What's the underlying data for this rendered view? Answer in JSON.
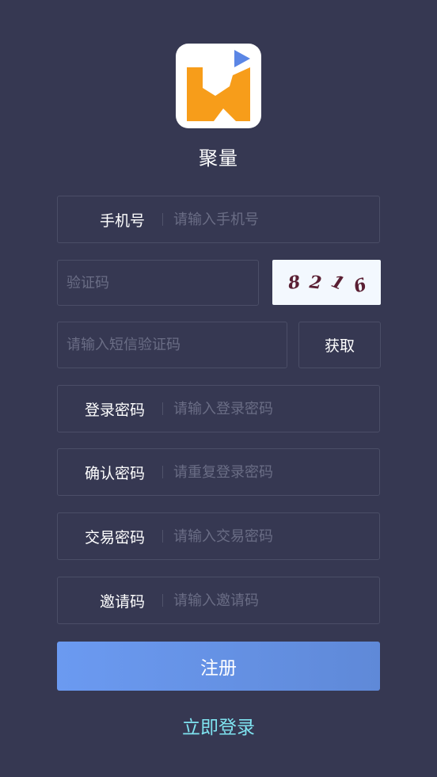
{
  "app": {
    "name": "聚量"
  },
  "colors": {
    "background": "#363852",
    "field_border": "#4b4e67",
    "button_gradient_start": "#6b9af1",
    "button_gradient_end": "#5f89d8",
    "link": "#7fe3f0",
    "logo_orange": "#f79d1a",
    "logo_blue": "#5b86e5"
  },
  "form": {
    "phone": {
      "label": "手机号",
      "placeholder": "请输入手机号"
    },
    "captcha_input": {
      "placeholder": "验证码"
    },
    "captcha_image": {
      "digits": [
        "8",
        "2",
        "1",
        "6"
      ]
    },
    "sms_code": {
      "placeholder": "请输入短信验证码",
      "get_label": "获取"
    },
    "login_password": {
      "label": "登录密码",
      "placeholder": "请输入登录密码"
    },
    "confirm_password": {
      "label": "确认密码",
      "placeholder": "请重复登录密码"
    },
    "trade_password": {
      "label": "交易密码",
      "placeholder": "请输入交易密码"
    },
    "invite_code": {
      "label": "邀请码",
      "placeholder": "请输入邀请码"
    }
  },
  "actions": {
    "register_label": "注册",
    "login_link_label": "立即登录"
  },
  "icons": {
    "logo": "app-logo-icon",
    "play": "play-triangle-icon"
  }
}
